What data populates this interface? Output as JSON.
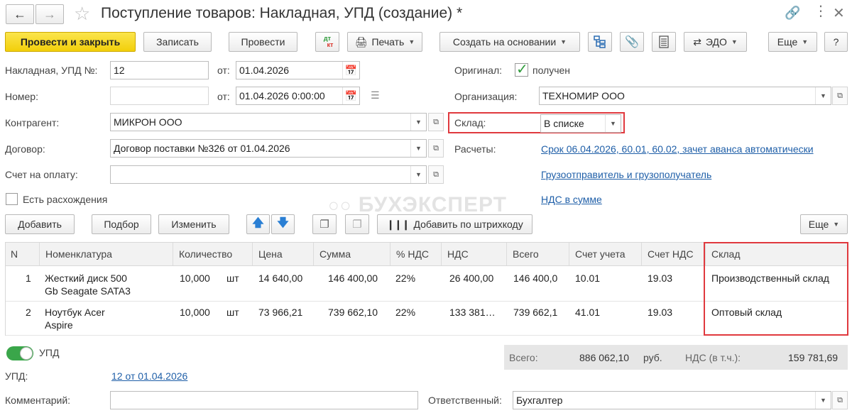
{
  "window": {
    "title": "Поступление товаров: Накладная, УПД (создание) *"
  },
  "toolbar": {
    "post_close": "Провести и закрыть",
    "save": "Записать",
    "post": "Провести",
    "dtkt_top": "дт",
    "dtkt_bottom": "кт",
    "print": "Печать",
    "create_based": "Создать на основании",
    "edo": "ЭДО",
    "more": "Еще",
    "help": "?"
  },
  "header": {
    "doc_label": "Накладная, УПД №:",
    "doc_number": "12",
    "from_label": "от:",
    "doc_date": "01.04.2026",
    "original_label": "Оригинал:",
    "original_value": "получен",
    "number_label": "Номер:",
    "number_value": "",
    "from2_label": "от:",
    "datetime": "01.04.2026  0:00:00",
    "org_label": "Организация:",
    "org_value": "ТЕХНОМИР ООО",
    "counterparty_label": "Контрагент:",
    "counterparty_value": "МИКРОН ООО",
    "warehouse_label": "Склад:",
    "warehouse_value": "В списке",
    "contract_label": "Договор:",
    "contract_value": "Договор поставки №326 от 01.04.2026",
    "settlements_label": "Расчеты:",
    "settlements_link": "Срок 06.04.2026, 60.01, 60.02, зачет аванса автоматически",
    "invoice_label": "Счет на оплату:",
    "invoice_value": "",
    "shipper_link": "Грузоотправитель и грузополучатель",
    "discrepancy_label": "Есть расхождения",
    "vat_link": "НДС в сумме",
    "watermark": "БУХЭКСПЕРТ"
  },
  "table_toolbar": {
    "add": "Добавить",
    "select": "Подбор",
    "edit": "Изменить",
    "barcode": "Добавить по штрихкоду",
    "more": "Еще"
  },
  "table": {
    "columns": [
      "N",
      "Номенклатура",
      "Количество",
      "Цена",
      "Сумма",
      "% НДС",
      "НДС",
      "Всего",
      "Счет учета",
      "Счет НДС",
      "Склад"
    ],
    "rows": [
      {
        "n": "1",
        "name1": "Жесткий диск 500",
        "name2": "Gb Seagate SATA3",
        "qty": "10,000",
        "unit": "шт",
        "price": "14 640,00",
        "sum": "146 400,00",
        "vat_rate": "22%",
        "vat": "26 400,00",
        "total": "146 400,0",
        "account": "10.01",
        "vat_account": "19.03",
        "warehouse": "Производственный склад"
      },
      {
        "n": "2",
        "name1": "Ноутбук Acer",
        "name2": "Aspire",
        "qty": "10,000",
        "unit": "шт",
        "price": "73 966,21",
        "sum": "739 662,10",
        "vat_rate": "22%",
        "vat": "133 381…",
        "total": "739 662,1",
        "account": "41.01",
        "vat_account": "19.03",
        "warehouse": "Оптовый склад"
      }
    ]
  },
  "footer": {
    "upd_toggle_label": "УПД",
    "upd_toggle_on": true,
    "total_label": "Всего:",
    "total_value": "886 062,10",
    "currency": "руб.",
    "vat_label": "НДС (в т.ч.):",
    "vat_value": "159 781,69",
    "upd_label": "УПД:",
    "upd_link": "12 от 01.04.2026",
    "comment_label": "Комментарий:",
    "comment_value": "",
    "responsible_label": "Ответственный:",
    "responsible_value": "Бухгалтер"
  },
  "colors": {
    "accent_yellow": "#f5d31a",
    "link": "#1f5fa8",
    "highlight_red": "#e0393e",
    "check_green": "#2e9b3a",
    "toggle_green": "#3aa64a"
  }
}
